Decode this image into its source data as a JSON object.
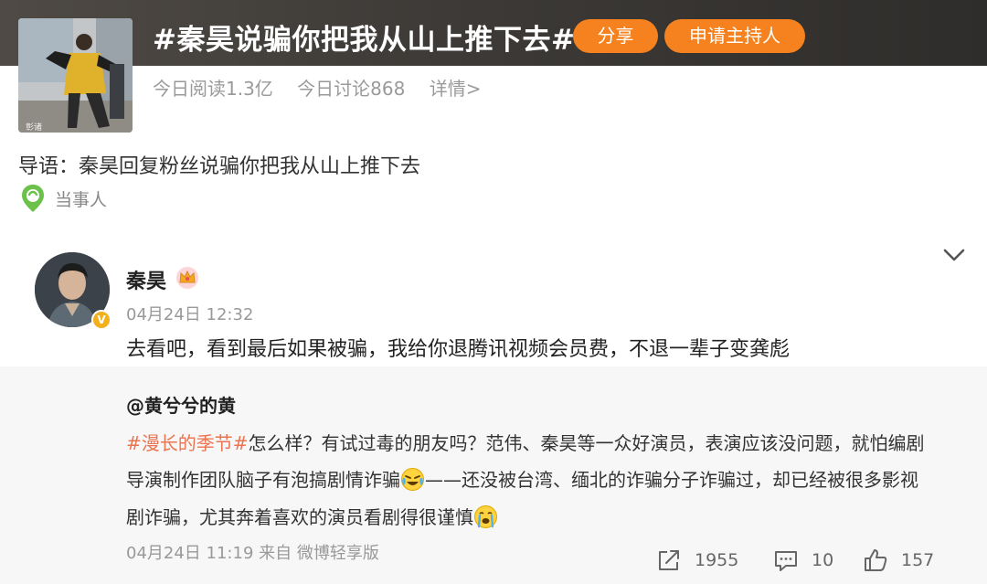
{
  "topic": {
    "title": "#秦昊说骗你把我从山上推下去#",
    "share_label": "分享",
    "host_label": "申请主持人",
    "read_today": "今日阅读1.3亿",
    "discuss_today": "今日讨论868",
    "details_link": "详情>",
    "intro": "导语：秦昊回复粉丝说骗你把我从山上推下去",
    "party_label": "当事人",
    "cover_watermark": "彰诸"
  },
  "post": {
    "author": "秦昊",
    "time": "04月24日 12:32",
    "text": "去看吧，看到最后如果被骗，我给你退腾讯视频会员费，不退一辈子变龚彪",
    "verified_badge": "V"
  },
  "repost": {
    "author": "@黄兮兮的黄",
    "line1_hashtag": "#漫长的季节#",
    "line1_rest": "怎么样？有试过毒的朋友吗？范伟、秦昊等一众好演员，表演应该没问题，就怕编剧",
    "line2_start": "导演制作团队脑子有泡搞剧情诈骗",
    "line2_end": "——还没被台湾、缅北的诈骗分子诈骗过，却已经被很多影视",
    "line3": "剧诈骗，尤其奔着喜欢的演员看剧得很谨慎",
    "meta": "04月24日 11:19 来自 微博轻享版",
    "forward_count": "1955",
    "comment_count": "10",
    "like_count": "157"
  },
  "colors": {
    "accent_orange": "#f5821f",
    "hashtag": "#eb7350",
    "header_bg": "#3d3a37",
    "repost_bg": "#f7f7f7"
  }
}
